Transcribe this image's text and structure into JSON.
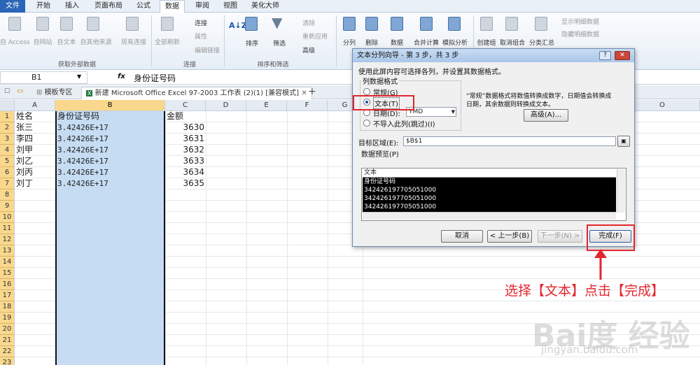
{
  "menu_tabs": [
    "文件",
    "开始",
    "插入",
    "页面布局",
    "公式",
    "数据",
    "审阅",
    "视图",
    "美化大师"
  ],
  "ribbon": {
    "external": [
      "自 Access",
      "自网站",
      "自文本",
      "自其他来源",
      "现有连接"
    ],
    "refresh": "全部刷新",
    "connections": [
      "连接",
      "属性",
      "编辑链接"
    ],
    "sort": "排序",
    "filter": "筛选",
    "filter_opts": [
      "清除",
      "重新应用",
      "高级"
    ],
    "tools": [
      "分列",
      "删除",
      "数据",
      "合并计算",
      "模拟分析"
    ],
    "outline": [
      "创建组",
      "取消组合",
      "分类汇总"
    ],
    "detail": [
      "显示明细数据",
      "隐藏明细数据"
    ],
    "groups": [
      "获取外部数据",
      "连接",
      "排序和筛选"
    ]
  },
  "namebox": "B1",
  "fx": "fx",
  "formula": "身份证号码",
  "workbook_tabs": [
    "模板专区",
    "新建 Microsoft Office Excel 97-2003 工作表 (2)(1) [兼容模式]"
  ],
  "columns": [
    "A",
    "B",
    "C",
    "D",
    "E",
    "F",
    "G",
    "O"
  ],
  "row_numbers": [
    "1",
    "2",
    "3",
    "4",
    "5",
    "6",
    "7",
    "8",
    "9",
    "10",
    "11",
    "12",
    "13",
    "14",
    "15",
    "16",
    "17",
    "18",
    "19",
    "20",
    "21",
    "22",
    "23",
    "24"
  ],
  "cells": {
    "A": [
      "姓名",
      "张三",
      "李四",
      "刘甲",
      "刘乙",
      "刘丙",
      "刘丁"
    ],
    "B": [
      "身份证号码",
      "3.42426E+17",
      "3.42426E+17",
      "3.42426E+17",
      "3.42426E+17",
      "3.42426E+17",
      "3.42426E+17"
    ],
    "C": [
      "金额",
      "3630",
      "3631",
      "3632",
      "3633",
      "3634",
      "3635"
    ]
  },
  "dialog": {
    "title": "文本分列向导 - 第 3 步，共 3 步",
    "help": "?",
    "close": "✕",
    "desc": "使用此屏内容可选择各列，并设置其数据格式。",
    "format_legend": "列数据格式",
    "opt_general": "常规(G)",
    "opt_text": "文本(T)",
    "opt_date": "日期(D):",
    "date_value": "YMD",
    "opt_skip": "不导入此列(跳过)(I)",
    "note1": "“常规”数据格式将数值转换成数字，日期值会转换成",
    "note2": "日期，其余数据则转换成文本。",
    "advanced": "高级(A)...",
    "target_label": "目标区域(E):",
    "target_value": "$B$1",
    "preview_label": "数据预览(P)",
    "preview_header": "文本",
    "preview_rows": [
      "身份证号码",
      "342426197705051000",
      "342426197705051000",
      "342426197705051000"
    ],
    "cancel": "取消",
    "back": "< 上一步(B)",
    "next": "下一步(N) >",
    "finish": "完成(F)"
  },
  "annotation": "选择【文本】点击【完成】",
  "watermark": "Bai度 经验",
  "watermark_url": "jingyan.baidu.com",
  "colors": {
    "highlight": "#c5dcf3",
    "red": "#e3262e",
    "file_tab": "#2a65b8"
  }
}
